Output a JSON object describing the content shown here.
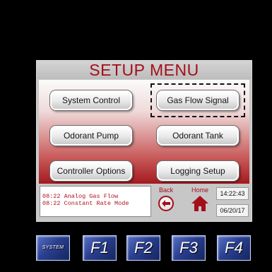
{
  "screen": {
    "title": "SETUP MENU",
    "menu": {
      "system_control": "System Control",
      "gas_flow_signal": "Gas Flow Signal",
      "odorant_pump": "Odorant Pump",
      "odorant_tank": "Odorant Tank",
      "controller_options": "Controller Options",
      "logging_setup": "Logging Setup"
    },
    "selected_item": "Gas Flow Signal"
  },
  "status": {
    "log_lines": [
      "08:22 Analog Gas Flow",
      "08:22 Constant Rate Mode"
    ],
    "back_label": "Back",
    "home_label": "Home",
    "time": "14:22:43",
    "date": "06/20/17"
  },
  "function_keys": {
    "system": "SYSTEM",
    "f1": "F1",
    "f2": "F2",
    "f3": "F3",
    "f4": "F4"
  },
  "colors": {
    "accent_red": "#a30f1a",
    "key_blue": "#2a3f8f",
    "panel_gray": "#c7c7c7"
  },
  "icons": {
    "back": "back-arrow-icon",
    "home": "home-icon"
  }
}
